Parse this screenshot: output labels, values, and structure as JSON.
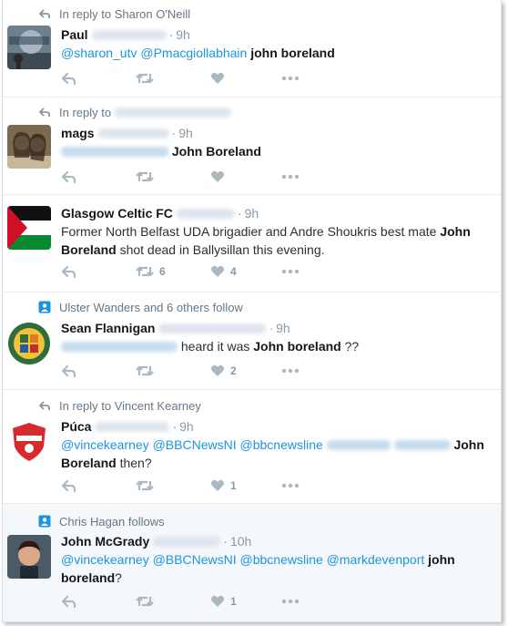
{
  "tweets": [
    {
      "context": "In reply to Sharon O'Neill",
      "context_icon": "reply-arrow-icon",
      "name": "Paul",
      "time": "9h",
      "mentions": [
        "@sharon_utv",
        "@Pmacgiollabhain"
      ],
      "bold": "john boreland",
      "replies": "",
      "retweets": "",
      "likes": ""
    },
    {
      "context": "In reply to",
      "context_icon": "reply-arrow-icon",
      "name": "mags",
      "time": "9h",
      "bold": "John Boreland",
      "replies": "",
      "retweets": "",
      "likes": ""
    },
    {
      "name": "Glasgow Celtic FC",
      "time": "9h",
      "text_before": "Former North Belfast UDA brigadier and Andre Shoukris best mate",
      "bold_1": "John",
      "bold_2": "Boreland",
      "text_after": "shot dead in Ballysillan this evening.",
      "replies": "",
      "retweets": "6",
      "likes": "4"
    },
    {
      "context": "Ulster Wanders and 6 others follow",
      "context_icon": "person-follow-icon",
      "name": "Sean Flannigan",
      "time": "9h",
      "text_before": "heard it was",
      "bold": "John boreland",
      "text_after": "??",
      "replies": "",
      "retweets": "",
      "likes": "2"
    },
    {
      "context": "In reply to Vincent Kearney",
      "context_icon": "reply-arrow-icon",
      "name": "Púca",
      "time": "9h",
      "mentions": [
        "@vincekearney",
        "@BBCNewsNI",
        "@bbcnewsline"
      ],
      "bold_1": "John",
      "bold_2": "Boreland",
      "text_after": "then?",
      "replies": "",
      "retweets": "",
      "likes": "1"
    },
    {
      "context": "Chris Hagan follows",
      "context_icon": "person-follow-icon",
      "name": "John McGrady",
      "time": "10h",
      "mentions": [
        "@vincekearney",
        "@BBCNewsNI",
        "@bbcnewsline",
        "@markdevenport"
      ],
      "bold_1": "john",
      "bold_2": "boreland",
      "text_after": "?",
      "replies": "",
      "retweets": "",
      "likes": "1"
    }
  ],
  "colors": {
    "link": "#1b95e0",
    "muted": "#8899a6",
    "context": "#657786",
    "highlight_bg": "#f5f8fa"
  }
}
